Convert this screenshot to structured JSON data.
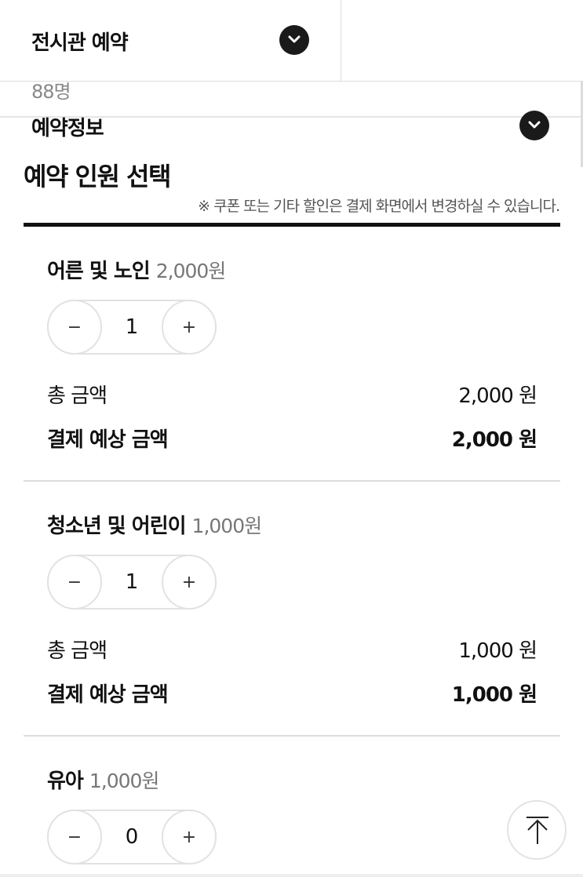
{
  "header": {
    "tab_exhibition": "전시관 예약",
    "peek_count": "88명",
    "reservation_info": "예약정보"
  },
  "section": {
    "title": "예약 인원 선택",
    "note": "※ 쿠폰 또는 기타 할인은 결제 화면에서 변경하실 수 있습니다."
  },
  "groups": [
    {
      "name": "어른 및 노인",
      "price": "2,000원",
      "count": "1",
      "minus": "−",
      "plus": "+",
      "total_label": "총 금액",
      "total_amount": "2,000 원",
      "expected_label": "결제 예상 금액",
      "expected_amount": "2,000 원"
    },
    {
      "name": "청소년 및 어린이",
      "price": "1,000원",
      "count": "1",
      "minus": "−",
      "plus": "+",
      "total_label": "총 금액",
      "total_amount": "1,000 원",
      "expected_label": "결제 예상 금액",
      "expected_amount": "1,000 원"
    },
    {
      "name": "유아",
      "price": "1,000원",
      "count": "0",
      "minus": "−",
      "plus": "+"
    }
  ],
  "icons": {
    "dropdown": "chevron-down-icon",
    "scroll_top": "arrow-up-icon"
  },
  "colors": {
    "text": "#111111",
    "muted": "#777777",
    "chevron_bg": "#1a1a1a",
    "divider": "#dddddd"
  }
}
